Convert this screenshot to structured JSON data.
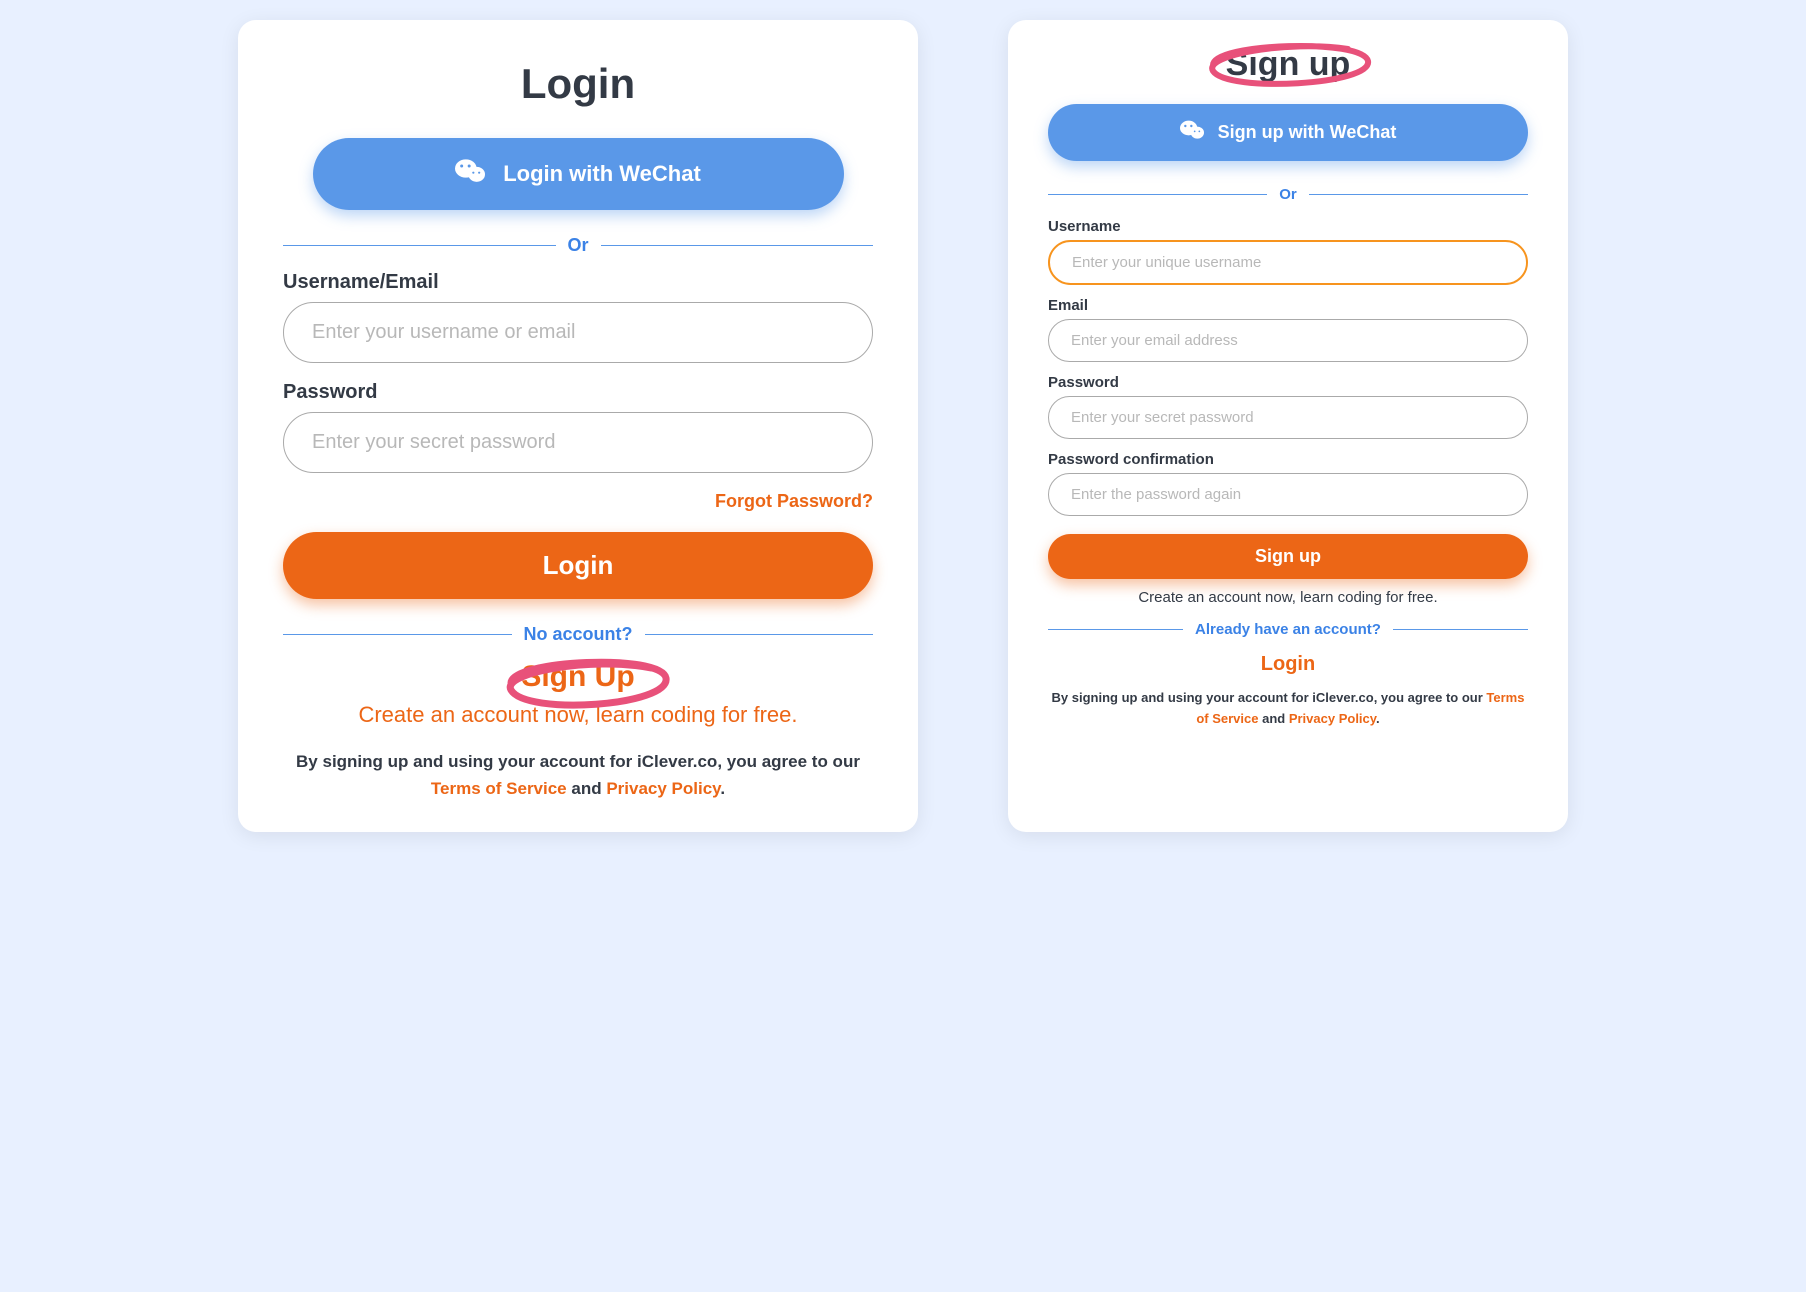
{
  "colors": {
    "blue": "#5a98e8",
    "orange": "#ec6616",
    "pink": "#e8517a"
  },
  "login": {
    "title": "Login",
    "wechat_label": "Login with WeChat",
    "or": "Or",
    "username_label": "Username/Email",
    "username_placeholder": "Enter your username or email",
    "password_label": "Password",
    "password_placeholder": "Enter your secret password",
    "forgot": "Forgot Password?",
    "submit": "Login",
    "no_account": "No account?",
    "signup_link": "Sign Up",
    "tagline": "Create an account now, learn coding for free.",
    "legal_prefix": "By signing up and using your account for iClever.co, you agree to our ",
    "tos": "Terms of Service",
    "and": " and ",
    "privacy": "Privacy Policy",
    "dot": "."
  },
  "signup": {
    "title": "Sign up",
    "wechat_label": "Sign up with WeChat",
    "or": "Or",
    "username_label": "Username",
    "username_placeholder": "Enter your unique username",
    "email_label": "Email",
    "email_placeholder": "Enter your email address",
    "password_label": "Password",
    "password_placeholder": "Enter your secret password",
    "confirm_label": "Password confirmation",
    "confirm_placeholder": "Enter the password again",
    "submit": "Sign up",
    "tagline": "Create an account now, learn coding for free.",
    "already": "Already have an account?",
    "login_link": "Login",
    "legal_prefix": "By signing up and using your account for iClever.co, you agree to our ",
    "tos": "Terms of Service",
    "and": " and ",
    "privacy": "Privacy Policy",
    "dot": "."
  }
}
